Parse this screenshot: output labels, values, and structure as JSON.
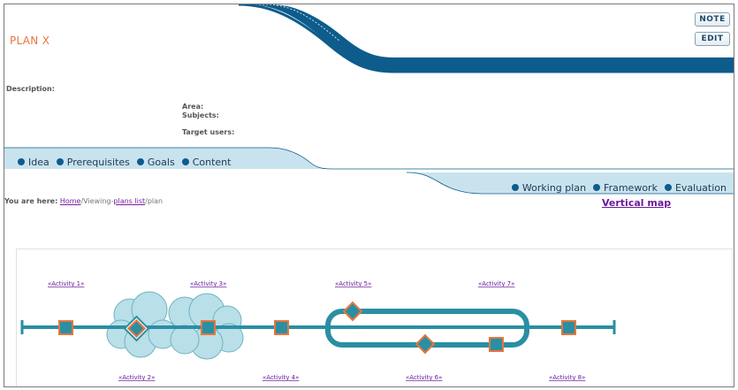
{
  "header": {
    "plan_title": "PLAN X",
    "note_button": "NOTE",
    "edit_button": "EDIT"
  },
  "details": {
    "description_label": "Description:",
    "area_label": "Area:",
    "subjects_label": "Subjects:",
    "target_users_label": "Target users:"
  },
  "tabs_left": [
    "Idea",
    "Prerequisites",
    "Goals",
    "Content"
  ],
  "tabs_right": [
    "Working plan",
    "Framework",
    "Evaluation"
  ],
  "breadcrumb": {
    "prefix": "You are here:",
    "home": "Home",
    "viewing": "/Viewing-",
    "plans_list": "plans list",
    "current": "/plan"
  },
  "vertical_map_link": "Vertical map",
  "activities": [
    "«Activity 1»",
    "«Activity 2»",
    "«Activity 3»",
    "«Activity 4»",
    "«Activity 5»",
    "«Activity 6»",
    "«Activity 7»",
    "«Activity 8»"
  ],
  "colors": {
    "accent_blue": "#0d5c8c",
    "light_blue": "#c9e3ee",
    "track_teal": "#2a8fa3",
    "node_orange": "#e8763c",
    "title_orange": "#e8763c",
    "link_purple": "#6a1b9a"
  }
}
